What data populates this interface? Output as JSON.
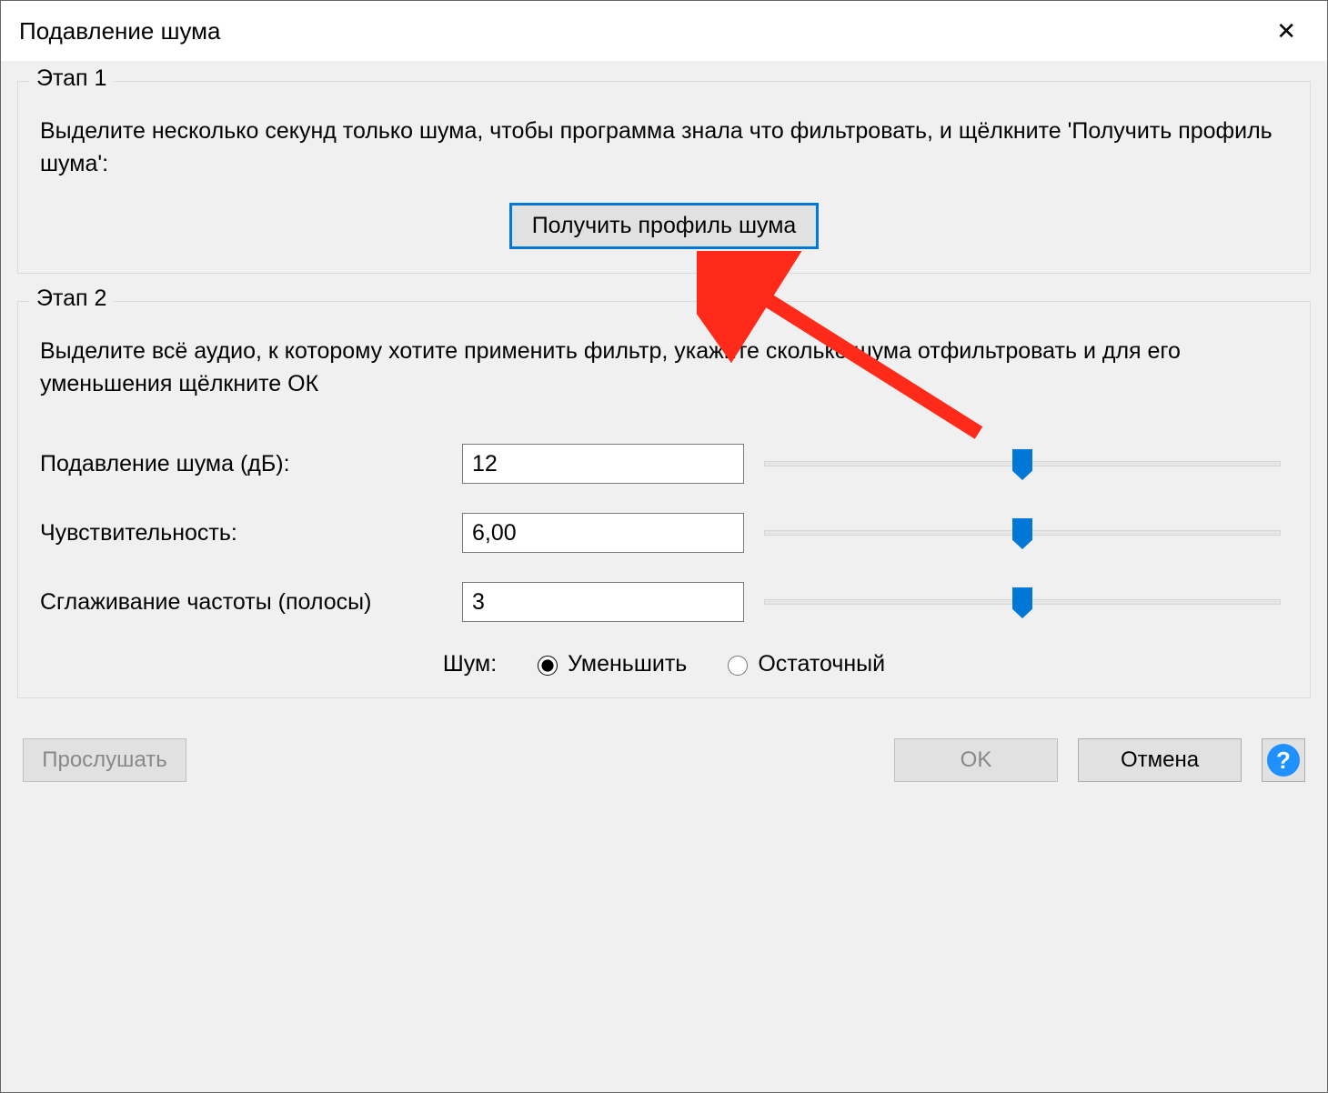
{
  "title": "Подавление шума",
  "step1": {
    "legend": "Этап 1",
    "text": "Выделите несколько секунд только шума, чтобы программа знала что фильтровать, и щёлкните 'Получить профиль шума':",
    "button": "Получить профиль шума"
  },
  "step2": {
    "legend": "Этап 2",
    "text": "Выделите всё аудио, к которому хотите применить фильтр, укажите сколько шума отфильтровать и для его уменьшения щёлкните ОК",
    "controls": {
      "reduction": {
        "label": "Подавление шума (дБ):",
        "value": "12",
        "slider_percent": 50
      },
      "sensitivity": {
        "label": "Чувствительность:",
        "value": "6,00",
        "slider_percent": 50
      },
      "smoothing": {
        "label": "Сглаживание частоты (полосы)",
        "value": "3",
        "slider_percent": 50
      }
    },
    "noise": {
      "label": "Шум:",
      "option_reduce": "Уменьшить",
      "option_residue": "Остаточный",
      "selected": "reduce"
    }
  },
  "buttons": {
    "preview": "Прослушать",
    "ok": "OK",
    "cancel": "Отмена",
    "help": "?"
  }
}
